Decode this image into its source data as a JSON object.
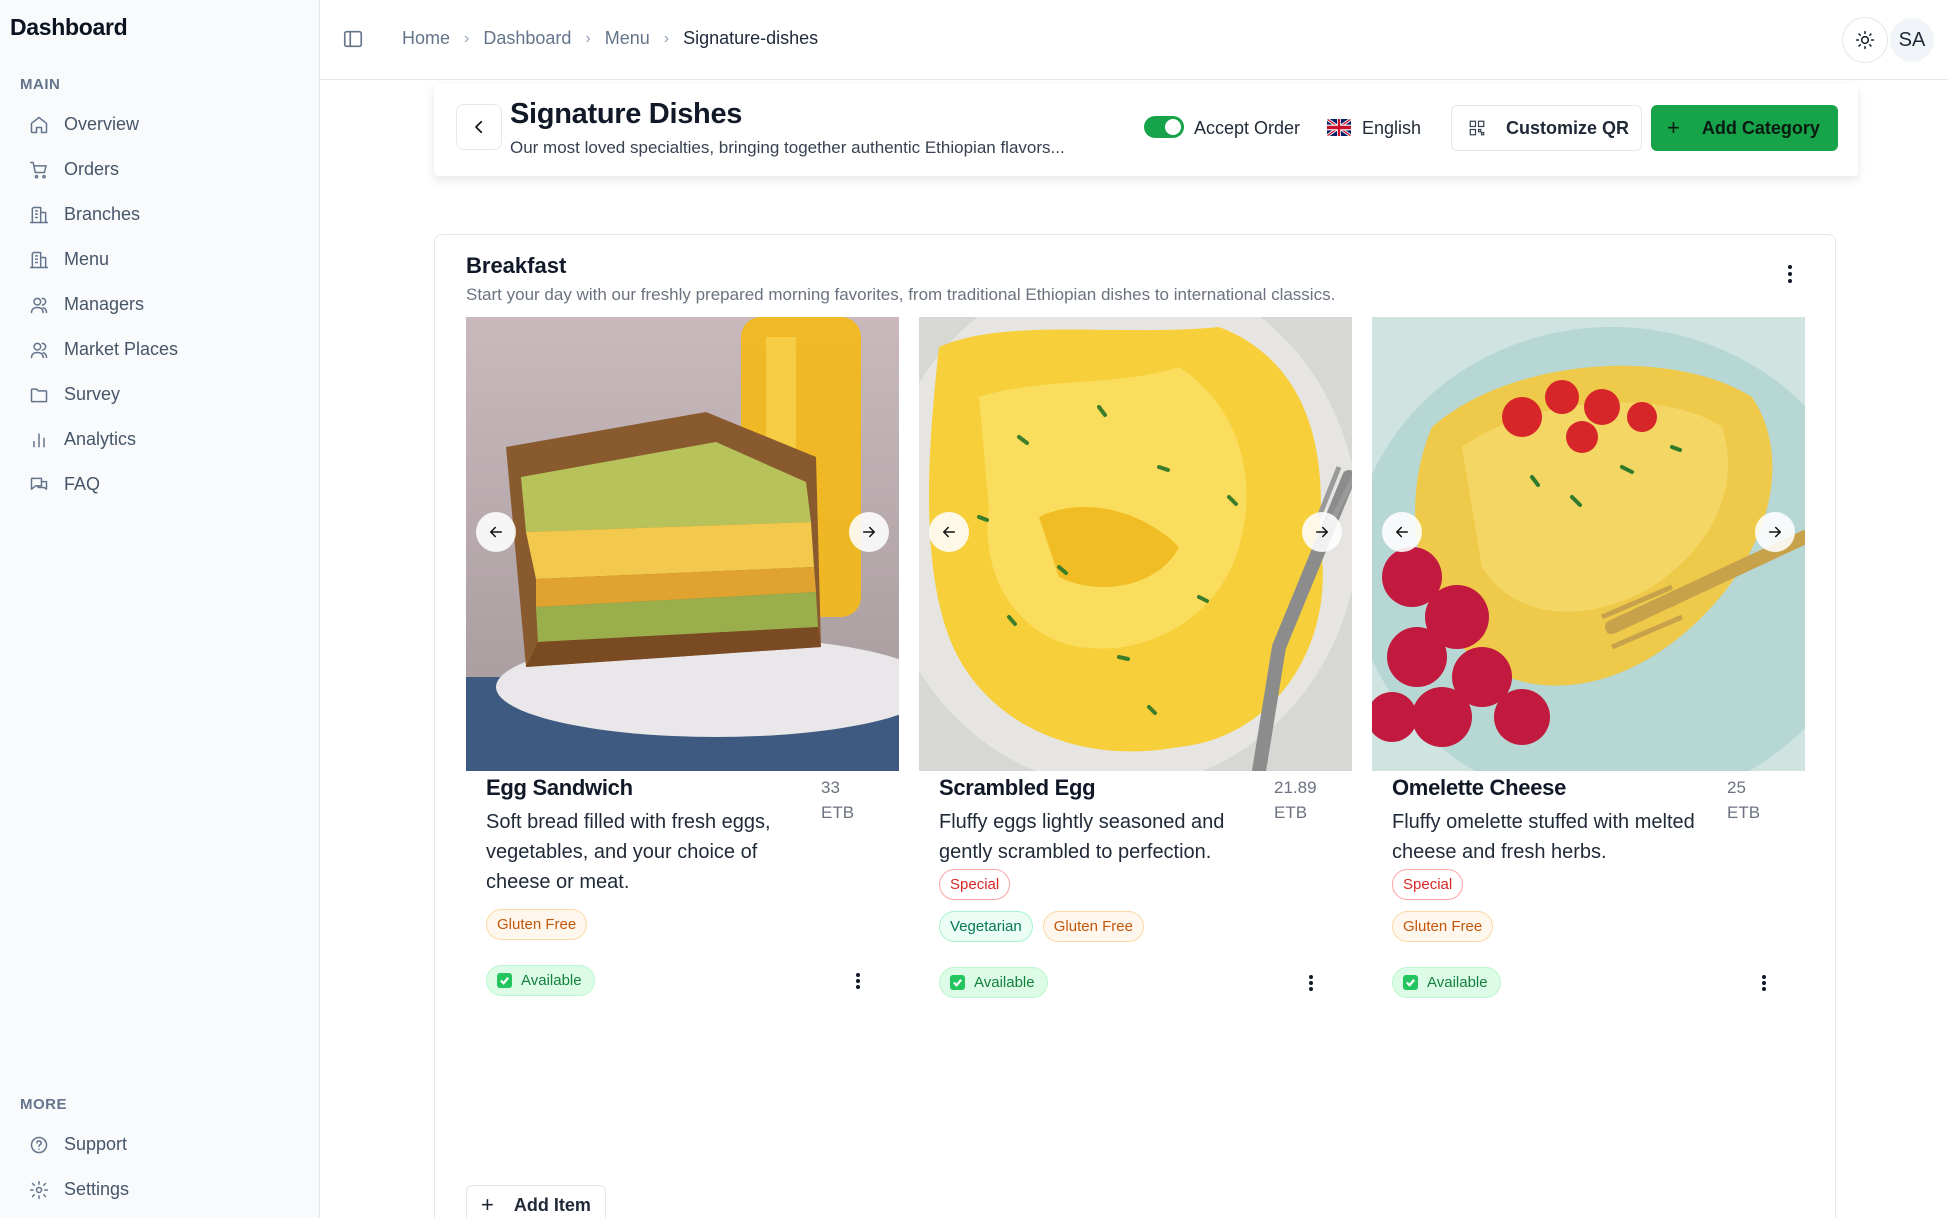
{
  "sidebar": {
    "brand": "Dashboard",
    "main_label": "MAIN",
    "items": [
      {
        "label": "Overview",
        "icon": "home-icon"
      },
      {
        "label": "Orders",
        "icon": "cart-icon"
      },
      {
        "label": "Branches",
        "icon": "building-icon"
      },
      {
        "label": "Menu",
        "icon": "building-icon"
      },
      {
        "label": "Managers",
        "icon": "users-icon"
      },
      {
        "label": "Market Places",
        "icon": "users-icon"
      },
      {
        "label": "Survey",
        "icon": "folder-icon"
      },
      {
        "label": "Analytics",
        "icon": "bar-chart-icon"
      },
      {
        "label": "FAQ",
        "icon": "chat-icon"
      }
    ],
    "more_label": "MORE",
    "more_items": [
      {
        "label": "Support",
        "icon": "help-icon"
      },
      {
        "label": "Settings",
        "icon": "gear-icon"
      }
    ]
  },
  "header": {
    "breadcrumbs": [
      "Home",
      "Dashboard",
      "Menu",
      "Signature-dishes"
    ],
    "avatar_initials": "SA"
  },
  "page": {
    "title": "Signature Dishes",
    "description": "Our most loved specialties, bringing together authentic Ethiopian flavors...",
    "accept_order_label": "Accept Order",
    "accept_order_on": true,
    "language": "English",
    "customize_qr_label": "Customize QR",
    "add_category_label": "Add Category",
    "accent_color": "#16a34a"
  },
  "category": {
    "title": "Breakfast",
    "description": "Start your day with our freshly prepared morning favorites, from traditional Ethiopian dishes to international classics.",
    "add_item_label": "Add Item",
    "items": [
      {
        "name": "Egg Sandwich",
        "price": "33",
        "currency": "ETB",
        "description": "Soft bread filled with fresh eggs, vegetables, and your choice of cheese or meat.",
        "tags_row1": [],
        "tags_row2": [
          "Gluten Free"
        ],
        "status": "Available"
      },
      {
        "name": "Scrambled Egg",
        "price": "21.89",
        "currency": "ETB",
        "description": "Fluffy eggs lightly seasoned and gently scrambled to perfection.",
        "tags_row1": [
          "Special"
        ],
        "tags_row2": [
          "Vegetarian",
          "Gluten Free"
        ],
        "status": "Available"
      },
      {
        "name": "Omelette Cheese",
        "price": "25",
        "currency": "ETB",
        "description": "Fluffy omelette stuffed with melted cheese and fresh herbs.",
        "tags_row1": [
          "Special"
        ],
        "tags_row2": [
          "Gluten Free"
        ],
        "status": "Available"
      }
    ]
  }
}
